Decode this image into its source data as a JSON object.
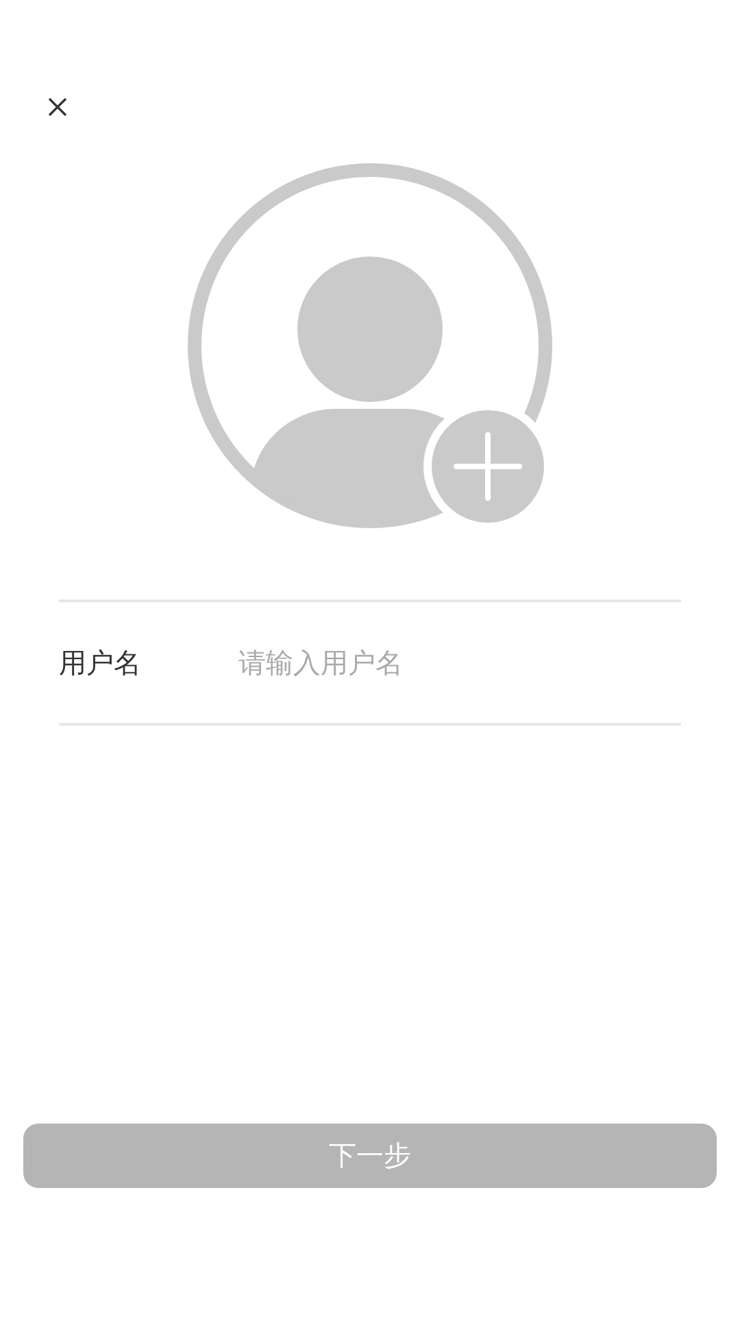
{
  "fields": [
    {
      "label": "用户名",
      "placeholder": "请输入用户名"
    }
  ],
  "next_button": {
    "label": "下一步",
    "disabled": true
  }
}
